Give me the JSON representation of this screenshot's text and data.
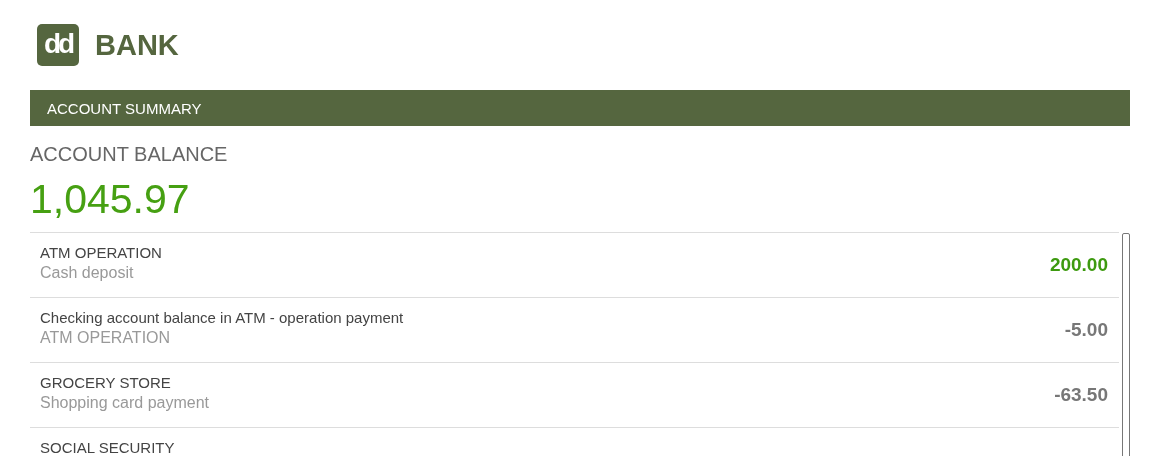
{
  "brand": {
    "logo": "dd",
    "name": "BANK"
  },
  "section_header": "ACCOUNT SUMMARY",
  "balance": {
    "label": "ACCOUNT BALANCE",
    "amount": "1,045.97"
  },
  "transactions": [
    {
      "title": "ATM OPERATION",
      "subtitle": "Cash deposit",
      "amount": "200.00",
      "kind": "credit"
    },
    {
      "title": "Checking account balance in ATM - operation payment",
      "subtitle": "ATM OPERATION",
      "amount": "-5.00",
      "kind": "debit"
    },
    {
      "title": "GROCERY STORE",
      "subtitle": "Shopping card payment",
      "amount": "-63.50",
      "kind": "debit"
    },
    {
      "title": "SOCIAL SECURITY"
    }
  ]
}
